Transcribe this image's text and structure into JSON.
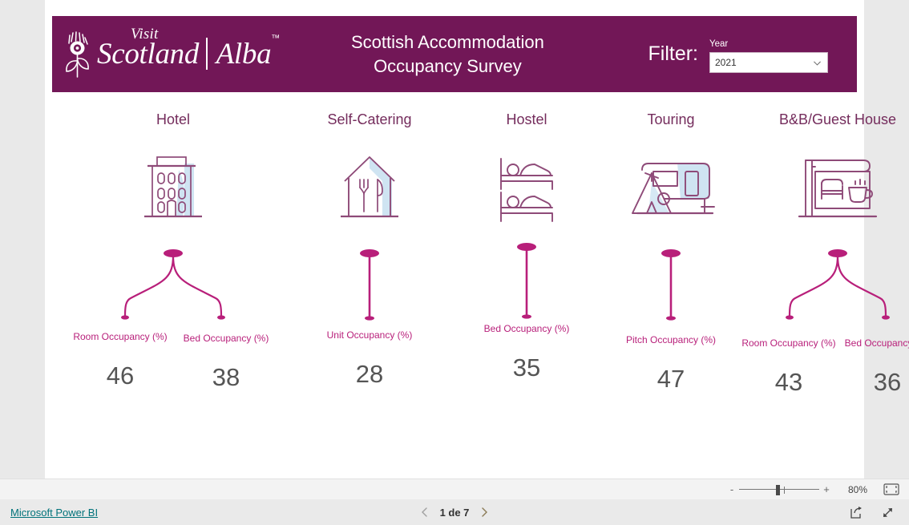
{
  "header": {
    "logo": {
      "visit": "Visit",
      "scotland": "Scotland",
      "alba": "Alba",
      "tm": "™"
    },
    "title": "Scottish Accommodation\nOccupancy Survey",
    "filter_label": "Filter:",
    "slicer_caption": "Year",
    "slicer_value": "2021",
    "background_color": "#721757"
  },
  "categories": [
    {
      "name": "Hotel",
      "icon": "hotel-building-icon",
      "connector": "branch-two",
      "metrics": [
        {
          "label": "Room Occupancy (%)",
          "value": "46"
        },
        {
          "label": "Bed Occupancy (%)",
          "value": "38"
        }
      ]
    },
    {
      "name": "Self-Catering",
      "icon": "house-cutlery-icon",
      "connector": "single",
      "metrics": [
        {
          "label": "Unit Occupancy (%)",
          "value": "28"
        }
      ]
    },
    {
      "name": "Hostel",
      "icon": "bunk-bed-icon",
      "connector": "single",
      "metrics": [
        {
          "label": "Bed Occupancy (%)",
          "value": "35"
        }
      ]
    },
    {
      "name": "Touring",
      "icon": "caravan-tent-icon",
      "connector": "single",
      "metrics": [
        {
          "label": "Pitch Occupancy (%)",
          "value": "47"
        }
      ]
    },
    {
      "name": "B&B/Guest House",
      "icon": "bed-coffee-sign-icon",
      "connector": "branch-two",
      "metrics": [
        {
          "label": "Room Occupancy (%)",
          "value": "43"
        },
        {
          "label": "Bed Occupancy (%)",
          "value": "36"
        }
      ]
    }
  ],
  "colors": {
    "brand_purple": "#721757",
    "category_title": "#742c5c",
    "metric_label": "#b81f7a",
    "metric_value": "#555555",
    "icon_stroke": "#8e4a78",
    "icon_shadow": "#cfe4f2",
    "link_teal": "#00727a"
  },
  "zoom_bar": {
    "minus": "-",
    "plus": "+",
    "percent": "80%",
    "fit_icon": "fit-to-page-icon"
  },
  "status_bar": {
    "link": "Microsoft Power BI",
    "prev_icon": "chevron-left-icon",
    "page_indicator": "1 de 7",
    "next_icon": "chevron-right-icon",
    "share_icon": "share-icon",
    "fullscreen_icon": "fullscreen-icon"
  }
}
